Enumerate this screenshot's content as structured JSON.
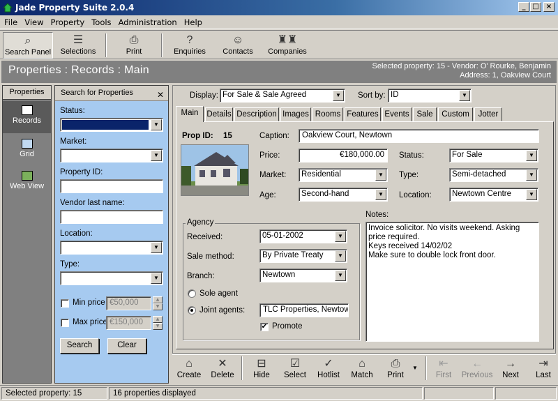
{
  "window": {
    "title": "Jade Property Suite 2.0.4"
  },
  "menu": [
    "File",
    "View",
    "Property",
    "Tools",
    "Administration",
    "Help"
  ],
  "toolbar": {
    "search_panel": "Search Panel",
    "selections": "Selections",
    "print": "Print",
    "enquiries": "Enquiries",
    "contacts": "Contacts",
    "companies": "Companies"
  },
  "header": {
    "title": "Properties : Records : Main",
    "selected": "Selected property: 15 - Vendor: O' Rourke, Benjamin",
    "address": "Address: 1, Oakview Court"
  },
  "sidebar": {
    "header": "Properties",
    "items": [
      "Records",
      "Grid",
      "Web View"
    ]
  },
  "search": {
    "header": "Search for Properties",
    "status_label": "Status:",
    "market_label": "Market:",
    "property_id_label": "Property ID:",
    "vendor_label": "Vendor last name:",
    "location_label": "Location:",
    "type_label": "Type:",
    "min_price_label": "Min price",
    "min_price_value": "€50,000",
    "max_price_label": "Max price",
    "max_price_value": "€150,000",
    "search_button": "Search",
    "clear_button": "Clear"
  },
  "filters": {
    "display_label": "Display:",
    "display_value": "For Sale & Sale Agreed",
    "sortby_label": "Sort by:",
    "sortby_value": "ID"
  },
  "tabs": [
    "Main",
    "Details",
    "Description",
    "Images",
    "Rooms",
    "Features",
    "Events",
    "Sale",
    "Custom",
    "Jotter"
  ],
  "record": {
    "prop_id_label": "Prop ID:",
    "prop_id": "15",
    "caption_label": "Caption:",
    "caption": "Oakview Court, Newtown",
    "price_label": "Price:",
    "price": "€180,000.00",
    "status_label": "Status:",
    "status": "For Sale",
    "market_label": "Market:",
    "market": "Residential",
    "type_label": "Type:",
    "type": "Semi-detached",
    "age_label": "Age:",
    "age": "Second-hand",
    "location_label": "Location:",
    "location": "Newtown Centre"
  },
  "agency": {
    "legend": "Agency",
    "received_label": "Received:",
    "received": "05-01-2002",
    "sale_method_label": "Sale method:",
    "sale_method": "By Private Treaty",
    "branch_label": "Branch:",
    "branch": "Newtown",
    "sole_agent_label": "Sole agent",
    "joint_agents_label": "Joint agents:",
    "joint_agents": "TLC Properties, Newtown",
    "promote_label": "Promote"
  },
  "notes": {
    "label": "Notes:",
    "lines": [
      "Invoice solicitor. No visits weekend. Asking price required.",
      "Keys received 14/02/02",
      "Make sure to double lock front door."
    ]
  },
  "actions": {
    "create": "Create",
    "delete": "Delete",
    "hide": "Hide",
    "select": "Select",
    "hotlist": "Hotlist",
    "match": "Match",
    "print": "Print",
    "first": "First",
    "previous": "Previous",
    "next": "Next",
    "last": "Last"
  },
  "status_bar": {
    "selected": "Selected property: 15",
    "count": "16 properties displayed"
  }
}
